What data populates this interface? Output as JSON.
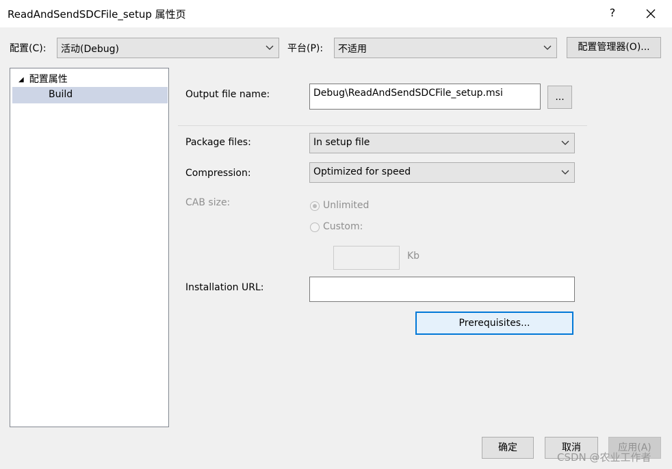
{
  "window": {
    "title": "ReadAndSendSDCFile_setup 属性页",
    "help": "?"
  },
  "config_bar": {
    "config_label": "配置(C):",
    "config_value": "活动(Debug)",
    "platform_label": "平台(P):",
    "platform_value": "不适用",
    "manager_button": "配置管理器(O)..."
  },
  "tree": {
    "root": "配置属性",
    "items": [
      {
        "label": "Build",
        "selected": true
      }
    ]
  },
  "form": {
    "output_label": "Output file name:",
    "output_value": "Debug\\ReadAndSendSDCFile_setup.msi",
    "browse_button": "...",
    "package_label": "Package files:",
    "package_value": "In setup file",
    "compression_label": "Compression:",
    "compression_value": "Optimized for speed",
    "cab_label": "CAB size:",
    "cab_unlimited": "Unlimited",
    "cab_custom": "Custom:",
    "cab_unit": "Kb",
    "install_url_label": "Installation URL:",
    "install_url_value": "",
    "prereq_button": "Prerequisites..."
  },
  "footer": {
    "ok": "确定",
    "cancel": "取消",
    "apply": "应用(A)"
  },
  "watermark": "CSDN @农业工作者",
  "colors": {
    "selection": "#cdd5e6",
    "focus_border": "#0078d7",
    "disabled_text": "#8f8f8f"
  }
}
